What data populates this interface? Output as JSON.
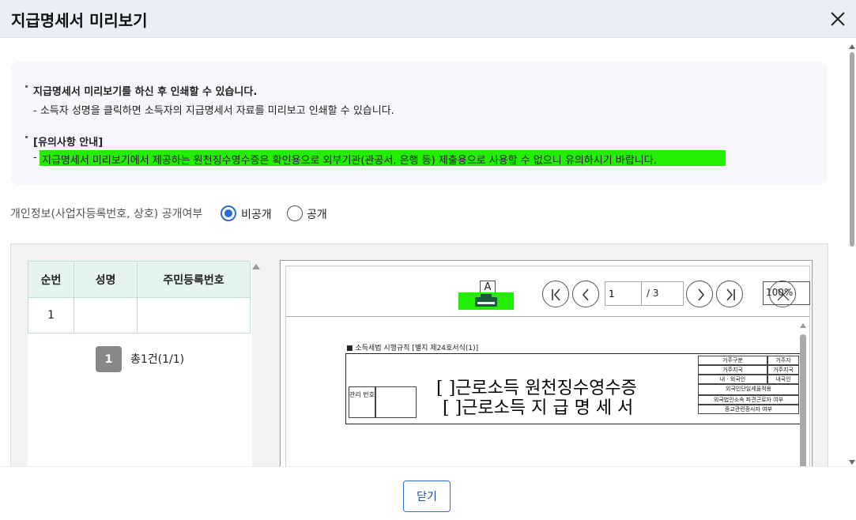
{
  "dialog": {
    "title": "지급명세서 미리보기",
    "close_button": "닫기"
  },
  "notice": {
    "line1": "지급명세서 미리보기를 하신 후 인쇄할 수 있습니다.",
    "line2": "- 소득자 성명을 클릭하면 소득자의 지급명세서 자료를 미리보고 인쇄할 수 있습니다.",
    "line3": "[유의사항 안내]",
    "line4_dash": "-",
    "line4": "지급명세서 미리보기에서 제공하는 원천징수영수증은 확인용으로 외부기관(관공서, 은행 등) 제출용으로 사용할 수 없으니 유의하시기 바랍니다."
  },
  "privacy": {
    "label": "개인정보(사업자등록번호, 상호) 공개여부",
    "options": [
      {
        "label": "비공개",
        "selected": true
      },
      {
        "label": "공개",
        "selected": false
      }
    ]
  },
  "list": {
    "headers": [
      "순번",
      "성명",
      "주민등록번호"
    ],
    "rows": [
      {
        "no": "1",
        "name": "",
        "rrn": ""
      }
    ],
    "page_badge": "1",
    "total": "총1건(1/1)"
  },
  "viewer": {
    "print_label": "A",
    "current_page": "1",
    "page_of": "/ 3",
    "zoom": "100%",
    "doc": {
      "caption": "■ 소득세법 시행규칙 [별지 제24호서식(1)]",
      "title1": "[ ]근로소득 원천징수영수증",
      "title2": "[ ]근로소득 지 급 명 세 서",
      "mgmt_label": "관리\n번호",
      "right_cells": [
        "거주구분",
        "거주자",
        "거주지국",
        "거주지국",
        "내 · 외국인",
        "내국인",
        "외국인단일세율적용",
        "외국법인소속 파견근로자 여부",
        "종교관련종사자 여부"
      ]
    }
  },
  "colors": {
    "accent": "#2b6bd6",
    "highlight": "#22ee00",
    "header_bg": "#e9eef7",
    "table_header_bg": "#e6f4f1"
  }
}
